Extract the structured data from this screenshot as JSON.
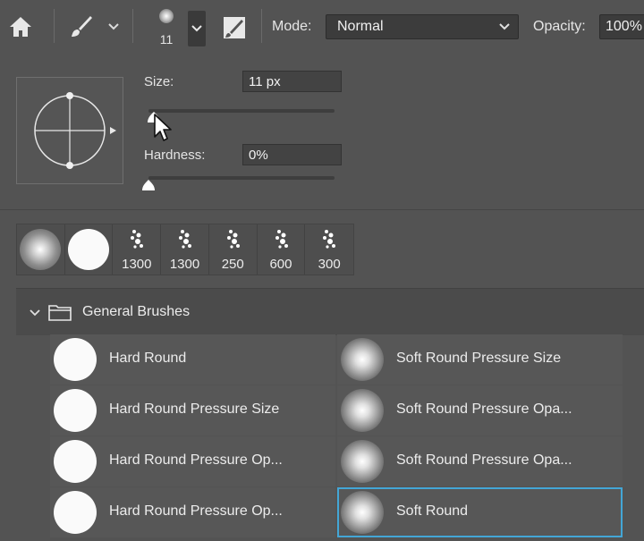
{
  "toolbar": {
    "brush_size": "11",
    "mode_label": "Mode:",
    "mode_value": "Normal",
    "opacity_label": "Opacity:",
    "opacity_value": "100%"
  },
  "picker": {
    "size_label": "Size:",
    "size_value": "11 px",
    "size_fraction": 0.03,
    "hardness_label": "Hardness:",
    "hardness_value": "0%",
    "hardness_fraction": 0.0
  },
  "recent_brushes": [
    {
      "kind": "soft",
      "label": ""
    },
    {
      "kind": "hard",
      "label": ""
    },
    {
      "kind": "spatter",
      "label": "1300"
    },
    {
      "kind": "spatter",
      "label": "1300"
    },
    {
      "kind": "spatter",
      "label": "250"
    },
    {
      "kind": "spatter",
      "label": "600"
    },
    {
      "kind": "spatter",
      "label": "300"
    }
  ],
  "group": {
    "title": "General Brushes",
    "brushes": [
      {
        "name": "Hard Round",
        "kind": "hard"
      },
      {
        "name": "Soft Round Pressure Size",
        "kind": "soft"
      },
      {
        "name": "Hard Round Pressure Size",
        "kind": "hard"
      },
      {
        "name": "Soft Round Pressure Opa...",
        "kind": "soft"
      },
      {
        "name": "Hard Round Pressure Op...",
        "kind": "hard"
      },
      {
        "name": "Soft Round Pressure Opa...",
        "kind": "soft"
      },
      {
        "name": "Hard Round Pressure Op...",
        "kind": "hard"
      },
      {
        "name": "Soft Round",
        "kind": "soft",
        "selected": true
      }
    ]
  },
  "colors": {
    "selection_outline": "#43a6d6",
    "background": "#535353"
  }
}
